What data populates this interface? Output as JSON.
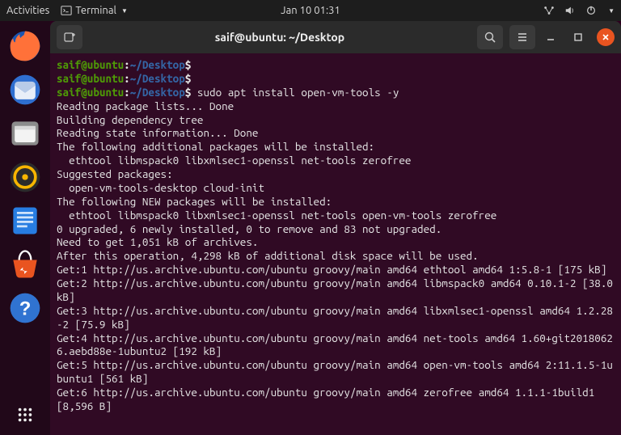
{
  "topbar": {
    "activities": "Activities",
    "app_indicator": "Terminal",
    "datetime": "Jan 10  01:31"
  },
  "dock": {
    "apps_label": "•••"
  },
  "window": {
    "title": "saif@ubuntu: ~/Desktop"
  },
  "prompt": {
    "user": "saif@ubuntu",
    "sep1": ":",
    "path": "~/Desktop",
    "sep2": "$"
  },
  "terminal": {
    "cmd_install": "sudo apt install open-vm-tools -y",
    "lines": [
      "Reading package lists... Done",
      "Building dependency tree",
      "Reading state information... Done",
      "The following additional packages will be installed:",
      "  ethtool libmspack0 libxmlsec1-openssl net-tools zerofree",
      "Suggested packages:",
      "  open-vm-tools-desktop cloud-init",
      "The following NEW packages will be installed:",
      "  ethtool libmspack0 libxmlsec1-openssl net-tools open-vm-tools zerofree",
      "0 upgraded, 6 newly installed, 0 to remove and 83 not upgraded.",
      "Need to get 1,051 kB of archives.",
      "After this operation, 4,298 kB of additional disk space will be used.",
      "Get:1 http://us.archive.ubuntu.com/ubuntu groovy/main amd64 ethtool amd64 1:5.8-1 [175 kB]",
      "Get:2 http://us.archive.ubuntu.com/ubuntu groovy/main amd64 libmspack0 amd64 0.10.1-2 [38.0 kB]",
      "Get:3 http://us.archive.ubuntu.com/ubuntu groovy/main amd64 libxmlsec1-openssl amd64 1.2.28-2 [75.9 kB]",
      "Get:4 http://us.archive.ubuntu.com/ubuntu groovy/main amd64 net-tools amd64 1.60+git20180626.aebd88e-1ubuntu2 [192 kB]",
      "Get:5 http://us.archive.ubuntu.com/ubuntu groovy/main amd64 open-vm-tools amd64 2:11.1.5-1ubuntu1 [561 kB]",
      "Get:6 http://us.archive.ubuntu.com/ubuntu groovy/main amd64 zerofree amd64 1.1.1-1build1 [8,596 B]"
    ]
  }
}
